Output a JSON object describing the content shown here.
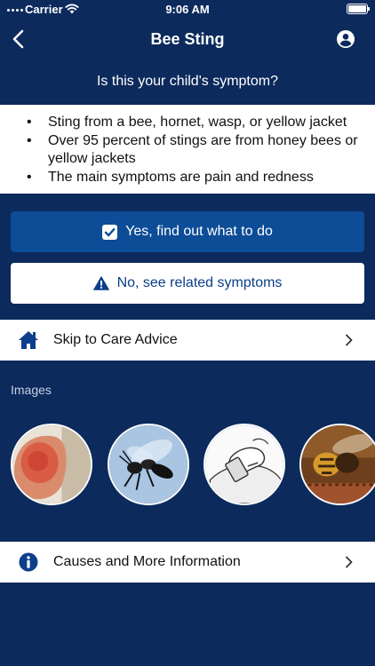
{
  "status_bar": {
    "carrier": "Carrier",
    "time": "9:06 AM"
  },
  "nav": {
    "title": "Bee Sting"
  },
  "prompt": {
    "question": "Is this your child's symptom?"
  },
  "symptoms": [
    "Sting from a bee, hornet, wasp, or yellow jacket",
    "Over 95 percent of stings are from honey bees or yellow jackets",
    "The main symptoms are pain and redness"
  ],
  "actions": {
    "yes_label": "Yes, find out what to do",
    "no_label": "No, see related symptoms"
  },
  "skip": {
    "label": "Skip to Care Advice"
  },
  "images": {
    "label": "Images"
  },
  "causes": {
    "label": "Causes and More Information"
  },
  "colors": {
    "background": "#0c2a5c",
    "primary_button": "#0d4c97",
    "link_blue": "#0c3f8a"
  }
}
